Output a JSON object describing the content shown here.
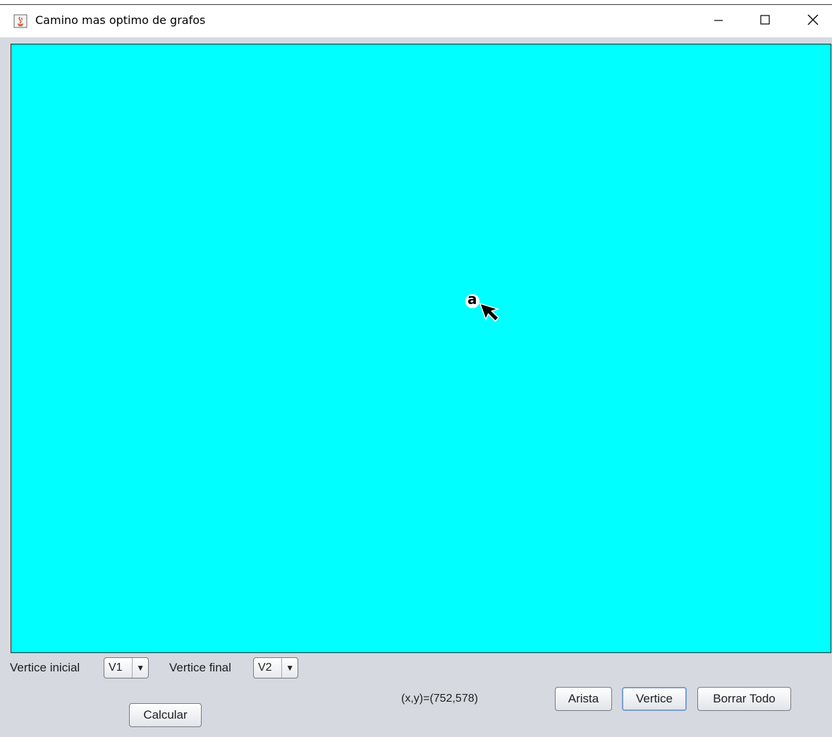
{
  "window": {
    "title": "Camino mas optimo de grafos"
  },
  "canvas": {
    "background": "#00ffff",
    "vertices": [
      {
        "label": "a"
      }
    ]
  },
  "controls": {
    "vertice_inicial_label": "Vertice inicial",
    "vertice_inicial_value": "V1",
    "vertice_final_label": "Vertice final",
    "vertice_final_value": "V2",
    "coords_readout": "(x,y)=(752,578)",
    "calcular_label": "Calcular",
    "arista_label": "Arista",
    "vertice_label": "Vertice",
    "borrar_label": "Borrar Todo"
  },
  "icons": {
    "app": "java-app-icon",
    "minimize": "minimize-icon",
    "maximize": "maximize-icon",
    "close": "close-icon",
    "dropdown": "triangle-down-icon",
    "cursor": "mouse-pointer-icon"
  }
}
